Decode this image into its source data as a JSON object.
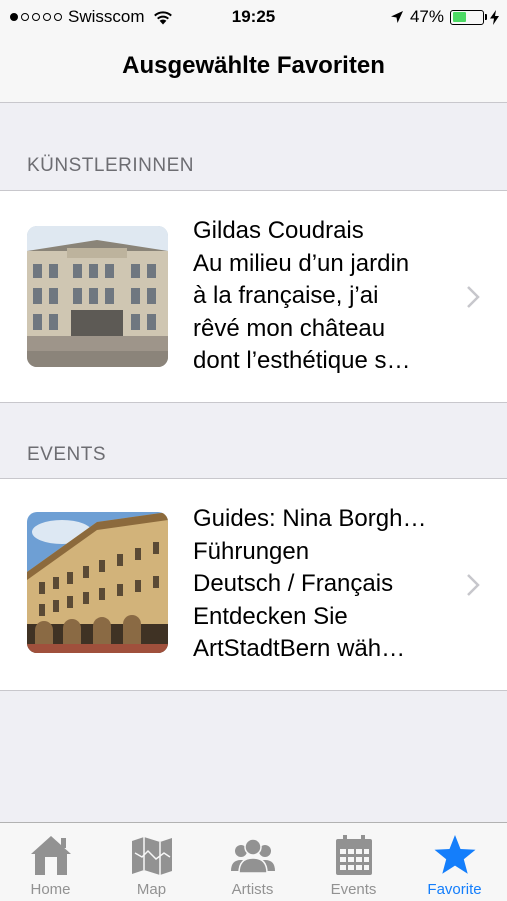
{
  "status_bar": {
    "carrier": "Swisscom",
    "time": "19:25",
    "battery": "47%",
    "battery_level": 0.47,
    "signal_bars_filled": 1,
    "signal_bars_total": 5
  },
  "nav": {
    "title": "Ausgewählte Favoriten"
  },
  "sections": [
    {
      "header": "KÜNSTLERINNEN",
      "items": [
        {
          "lines": [
            "Gildas Coudrais",
            "Au milieu d’un jardin",
            "à la française, j’ai",
            "rêvé mon château",
            "dont l’esthétique s…"
          ],
          "thumbnail": "building-photo"
        }
      ]
    },
    {
      "header": "EVENTS",
      "items": [
        {
          "lines": [
            "Guides: Nina Borgh…",
            "Führungen",
            "Deutsch / Français",
            "Entdecken Sie",
            "ArtStadtBern wäh…"
          ],
          "thumbnail": "arcade-building-photo"
        }
      ]
    }
  ],
  "tab_bar": {
    "tabs": [
      {
        "label": "Home",
        "icon": "home-icon"
      },
      {
        "label": "Map",
        "icon": "map-icon"
      },
      {
        "label": "Artists",
        "icon": "artists-icon"
      },
      {
        "label": "Events",
        "icon": "calendar-icon"
      },
      {
        "label": "Favorite",
        "icon": "star-icon",
        "active": true
      }
    ],
    "active_color": "#147efb",
    "inactive_color": "#929292"
  }
}
